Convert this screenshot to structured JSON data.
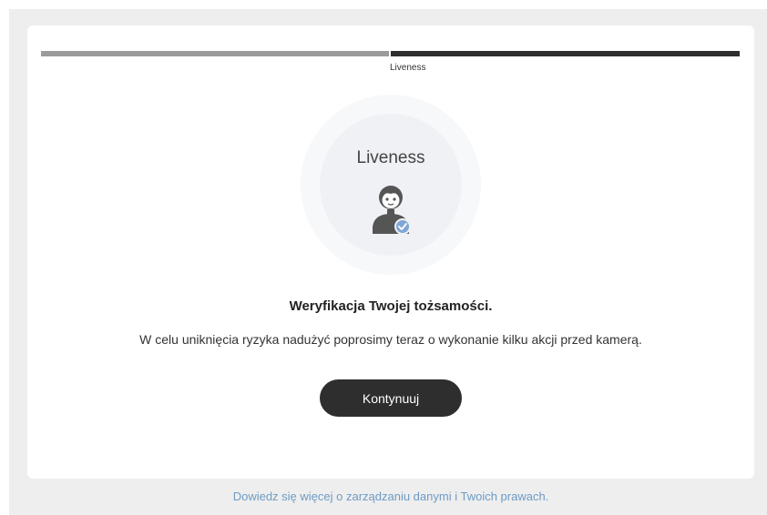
{
  "progress": {
    "current_step_label": "Liveness",
    "steps_completed": 1,
    "steps_total": 2
  },
  "liveness": {
    "circle_title": "Liveness",
    "icon": "user-verified-icon"
  },
  "main": {
    "heading": "Weryfikacja Twojej tożsamości.",
    "description": "W celu uniknięcia ryzyka nadużyć poprosimy teraz o wykonanie kilku akcji przed kamerą.",
    "continue_label": "Kontynuuj"
  },
  "footer": {
    "link_text": "Dowiedz się więcej o zarządzaniu danymi i Twoich prawach."
  },
  "colors": {
    "button_bg": "#2e2e2e",
    "progress_done": "#9b9b9b",
    "progress_active": "#2f2f2f",
    "link": "#6e9bc4",
    "check_badge": "#7fa6d6"
  }
}
